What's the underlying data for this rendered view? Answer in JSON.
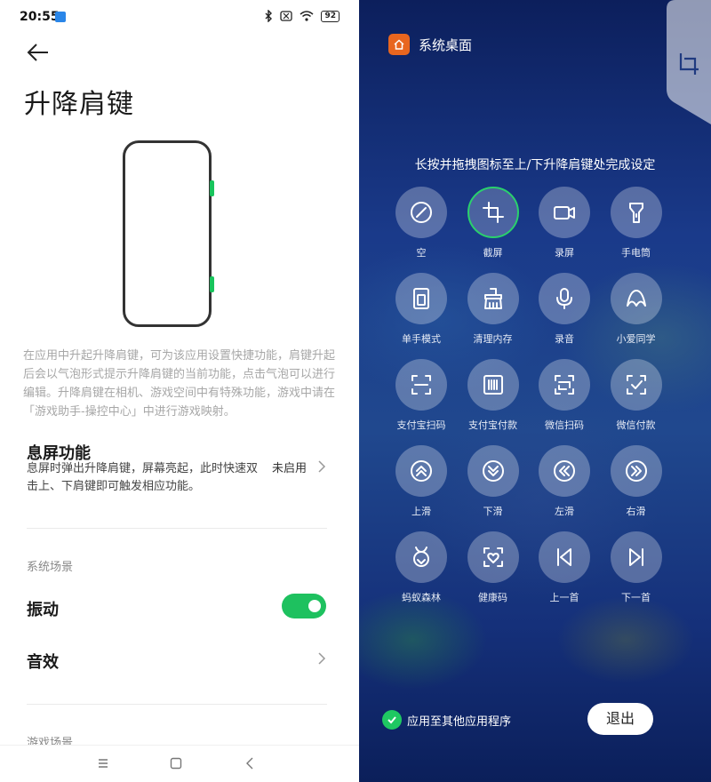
{
  "status_bar": {
    "time": "20:55",
    "battery": "92"
  },
  "settings": {
    "title": "升降肩键",
    "description": "在应用中升起升降肩键，可为该应用设置快捷功能，肩键升起后会以气泡形式提示升降肩键的当前功能，点击气泡可以进行编辑。升降肩键在相机、游戏空间中有特殊功能，游戏中请在「游戏助手-操控中心」中进行游戏映射。",
    "screen_off": {
      "title": "息屏功能",
      "subtitle": "息屏时弹出升降肩键，屏幕亮起，此时快速双击上、下肩键即可触发相应功能。",
      "value": "未启用"
    },
    "system_section_label": "系统场景",
    "vibration_label": "振动",
    "vibration_on": true,
    "sound_label": "音效",
    "game_section_label": "游戏场景"
  },
  "overlay": {
    "app_name": "系统桌面",
    "instruction": "长按并拖拽图标至上/下升降肩键处完成设定",
    "functions": [
      {
        "label": "空",
        "icon": "none-icon",
        "selected": false
      },
      {
        "label": "截屏",
        "icon": "crop-icon",
        "selected": true
      },
      {
        "label": "录屏",
        "icon": "video-camera-icon",
        "selected": false
      },
      {
        "label": "手电筒",
        "icon": "flashlight-icon",
        "selected": false
      },
      {
        "label": "单手模式",
        "icon": "one-hand-icon",
        "selected": false
      },
      {
        "label": "清理内存",
        "icon": "broom-icon",
        "selected": false
      },
      {
        "label": "录音",
        "icon": "microphone-icon",
        "selected": false
      },
      {
        "label": "小爱同学",
        "icon": "assistant-icon",
        "selected": false
      },
      {
        "label": "支付宝扫码",
        "icon": "scan-icon",
        "selected": false
      },
      {
        "label": "支付宝付款",
        "icon": "barcode-icon",
        "selected": false
      },
      {
        "label": "微信扫码",
        "icon": "wechat-scan-icon",
        "selected": false
      },
      {
        "label": "微信付款",
        "icon": "wechat-pay-icon",
        "selected": false
      },
      {
        "label": "上滑",
        "icon": "swipe-up-icon",
        "selected": false
      },
      {
        "label": "下滑",
        "icon": "swipe-down-icon",
        "selected": false
      },
      {
        "label": "左滑",
        "icon": "swipe-left-icon",
        "selected": false
      },
      {
        "label": "右滑",
        "icon": "swipe-right-icon",
        "selected": false
      },
      {
        "label": "蚂蚁森林",
        "icon": "ant-forest-icon",
        "selected": false
      },
      {
        "label": "健康码",
        "icon": "health-code-icon",
        "selected": false
      },
      {
        "label": "上一首",
        "icon": "previous-track-icon",
        "selected": false
      },
      {
        "label": "下一首",
        "icon": "next-track-icon",
        "selected": false
      }
    ],
    "apply_label": "应用至其他应用程序",
    "apply_checked": true,
    "exit_label": "退出"
  },
  "colors": {
    "accent": "#1ec15f",
    "home_icon": "#e8661f"
  }
}
